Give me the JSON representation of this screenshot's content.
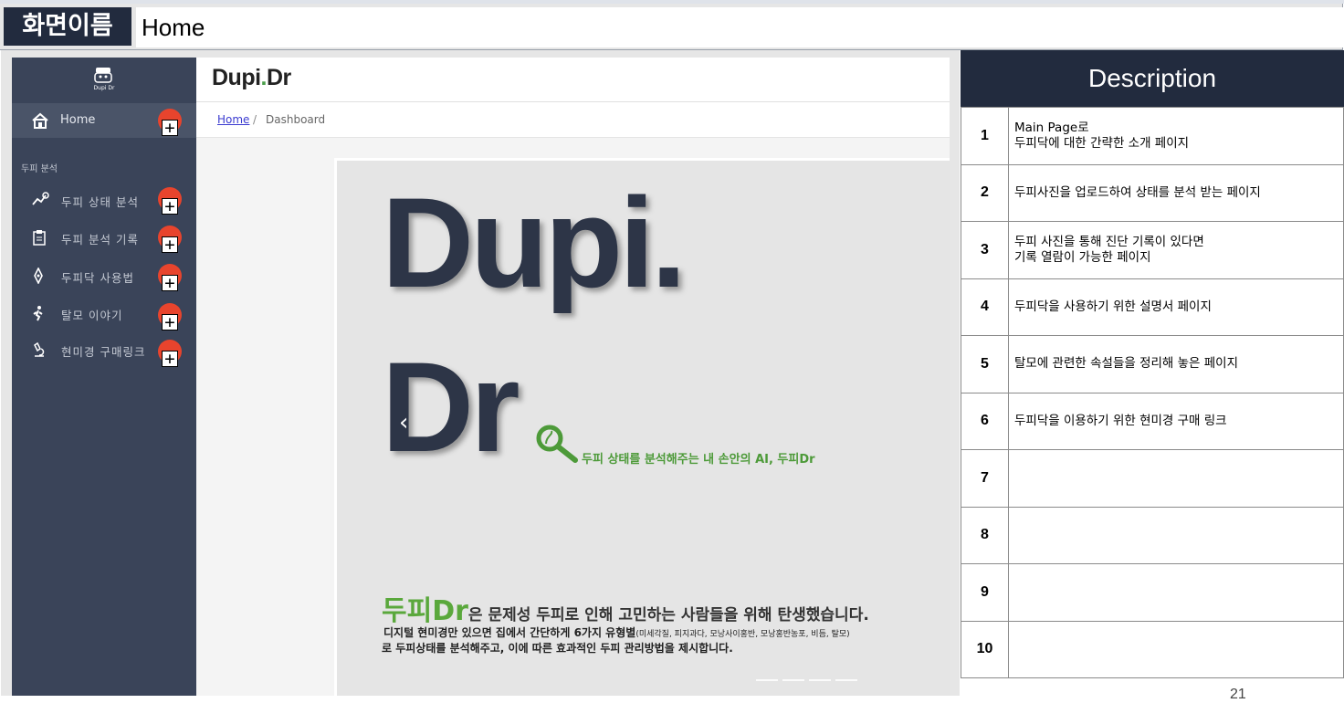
{
  "screen": {
    "label": "화면이름",
    "name": "Home"
  },
  "app": {
    "logo_text": "Dupi Dr",
    "brand_main": "Dupi",
    "brand_dot": ".",
    "brand_suffix": "Dr",
    "nav": {
      "home": "Home",
      "group": "두피 분석",
      "items": [
        "두피 상태 분석",
        "두피 분석 기록",
        "두피닥 사용법",
        "탈모 이야기",
        "현미경 구매링크"
      ]
    },
    "breadcrumb": {
      "home": "Home",
      "sep": "/",
      "current": "Dashboard"
    },
    "banner": {
      "title_line1": "Dupi.",
      "title_line2": "Dr",
      "prev": "‹",
      "tagline": "두피 상태를 분석해주는 내 손안의 AI, 두피Dr",
      "mission_highlight": "두피Dr",
      "mission_rest": "은 문제성 두피로 인해 고민하는 사람들을 위해 탄생했습니다.",
      "desc_line1": "디지털 현미경만 있으면 집에서 간단하게 6가지 유형별",
      "desc_line1_small": "(미세각질, 피지과다, 모낭사이홍반, 모낭홍반농포, 비듬, 탈모)",
      "desc_line2": "로 두피상태를 분석해주고, 이에 따른 효과적인 두피 관리방법을 제시합니다."
    }
  },
  "marker_symbol": "+",
  "description": {
    "title": "Description",
    "rows": [
      {
        "num": "1",
        "line1": "Main Page로",
        "line2": "두피닥에 대한 간략한 소개 페이지"
      },
      {
        "num": "2",
        "line1": "두피사진을 업로드하여 상태를 분석 받는 페이지",
        "line2": ""
      },
      {
        "num": "3",
        "line1": "두피 사진을 통해 진단 기록이 있다면",
        "line2": "기록 열람이 가능한 페이지"
      },
      {
        "num": "4",
        "line1": "두피닥을 사용하기 위한 설명서 페이지",
        "line2": ""
      },
      {
        "num": "5",
        "line1": "탈모에 관련한 속설들을 정리해 놓은 페이지",
        "line2": ""
      },
      {
        "num": "6",
        "line1": "두피닥을 이용하기 위한 현미경 구매 링크",
        "line2": ""
      },
      {
        "num": "7",
        "line1": "",
        "line2": ""
      },
      {
        "num": "8",
        "line1": "",
        "line2": ""
      },
      {
        "num": "9",
        "line1": "",
        "line2": ""
      },
      {
        "num": "10",
        "line1": "",
        "line2": ""
      }
    ]
  },
  "page_number": "21"
}
